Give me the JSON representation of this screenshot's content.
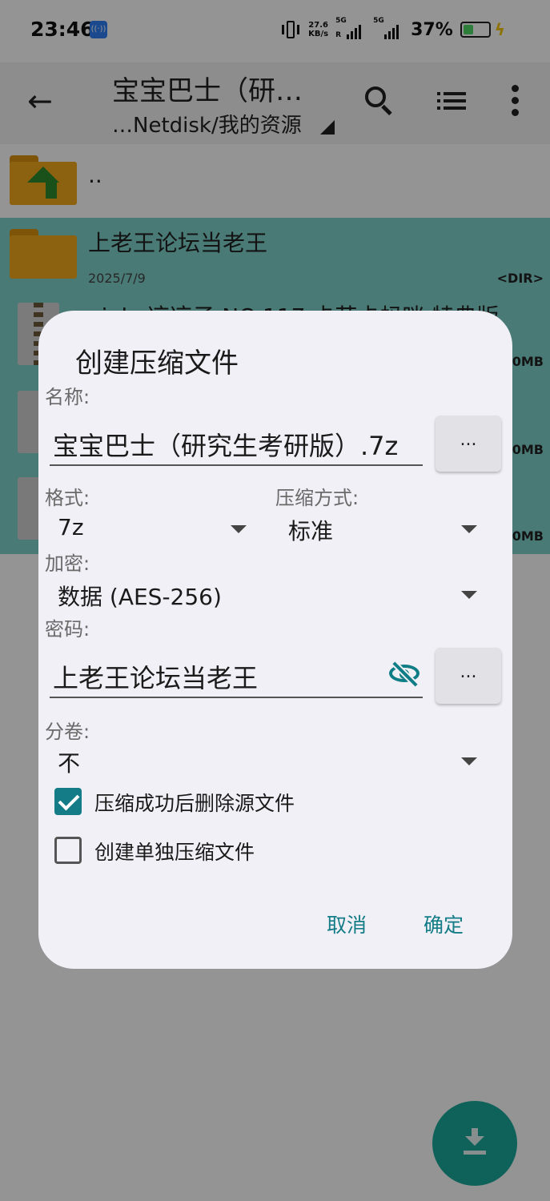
{
  "status_bar": {
    "time": "23:46",
    "net_speed_value": "27.6",
    "net_speed_unit": "KB/s",
    "sim1_label": "5G",
    "sim1_sub": "R",
    "sim2_label": "5G",
    "battery_percent": "37%"
  },
  "toolbar": {
    "title": "宝宝巴士（研…",
    "subtitle": "…Netdisk/我的资源"
  },
  "files": [
    {
      "name": "..",
      "date": "",
      "size": ""
    },
    {
      "name": "上老王论坛当老王",
      "date": "2025/7/9",
      "size": "<DIR>"
    },
    {
      "name": "xiaka凉凉子 NO.117 卡芙卡蚂咪 特典版",
      "size": "0MB"
    },
    {
      "size": "0MB"
    },
    {
      "size": "0MB"
    }
  ],
  "dialog": {
    "title": "创建压缩文件",
    "name_label": "名称:",
    "name_value": "宝宝巴士（研究生考研版）.7z",
    "browse_label": "...",
    "format_label": "格式:",
    "format_value": "7z",
    "method_label": "压缩方式:",
    "method_value": "标准",
    "encrypt_label": "加密:",
    "encrypt_value": "数据 (AES-256)",
    "password_label": "密码:",
    "password_value": "上老王论坛当老王",
    "volume_label": "分卷:",
    "volume_value": "不",
    "delete_source_label": "压缩成功后删除源文件",
    "delete_source_checked": true,
    "separate_label": "创建单独压缩文件",
    "separate_checked": false,
    "cancel_label": "取消",
    "ok_label": "确定"
  },
  "colors": {
    "accent": "#137c86",
    "selected_row": "#7fd3cb",
    "folder": "#f2a81d",
    "fab": "#1aa99b"
  },
  "icons": [
    "back-arrow-icon",
    "search-icon",
    "list-icon",
    "more-vert-icon",
    "folder-up-icon",
    "folder-icon",
    "zip-file-icon",
    "eye-off-icon",
    "download-icon"
  ]
}
